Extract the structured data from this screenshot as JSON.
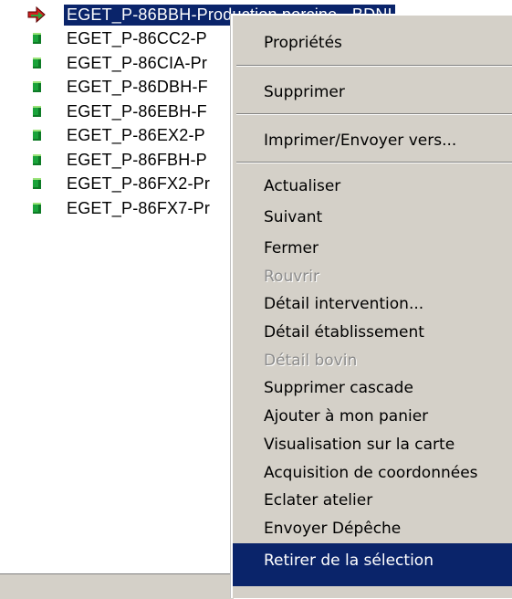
{
  "tree": {
    "items": [
      {
        "label": "EGET_P-86BBH-Production porcine - BDNI",
        "selected": true,
        "icon": "red-green-arrow-icon"
      },
      {
        "label": "EGET_P-86CC2-P",
        "selected": false,
        "icon": "green-square-icon"
      },
      {
        "label": "EGET_P-86CIA-Pr",
        "selected": false,
        "icon": "green-square-icon"
      },
      {
        "label": "EGET_P-86DBH-F",
        "selected": false,
        "icon": "green-square-icon"
      },
      {
        "label": "EGET_P-86EBH-F",
        "selected": false,
        "icon": "green-square-icon"
      },
      {
        "label": "EGET_P-86EX2-P",
        "selected": false,
        "icon": "green-square-icon"
      },
      {
        "label": "EGET_P-86FBH-P",
        "selected": false,
        "icon": "green-square-icon"
      },
      {
        "label": "EGET_P-86FX2-Pr",
        "selected": false,
        "icon": "green-square-icon"
      },
      {
        "label": "EGET_P-86FX7-Pr",
        "selected": false,
        "icon": "green-square-icon"
      }
    ]
  },
  "context_menu": {
    "items": [
      {
        "label": "Propriétés",
        "enabled": true
      },
      {
        "label": "Supprimer",
        "enabled": true
      },
      {
        "label": "Imprimer/Envoyer vers...",
        "enabled": true
      },
      {
        "label": "Actualiser",
        "enabled": true
      },
      {
        "label": "Suivant",
        "enabled": true
      },
      {
        "label": "Fermer",
        "enabled": true
      },
      {
        "label": "Rouvrir",
        "enabled": false
      },
      {
        "label": "Détail intervention...",
        "enabled": true
      },
      {
        "label": "Détail établissement",
        "enabled": true
      },
      {
        "label": "Détail bovin",
        "enabled": false
      },
      {
        "label": "Supprimer cascade",
        "enabled": true
      },
      {
        "label": "Ajouter à mon panier",
        "enabled": true
      },
      {
        "label": "Visualisation sur la carte",
        "enabled": true
      },
      {
        "label": "Acquisition de coordonnées",
        "enabled": true
      },
      {
        "label": "Eclater atelier",
        "enabled": true
      },
      {
        "label": "Envoyer Dépêche",
        "enabled": true
      },
      {
        "label": "Retirer de la sélection",
        "enabled": true,
        "highlighted": true
      }
    ]
  },
  "colors": {
    "selection": "#0a246a",
    "menu_bg": "#d4d0c8",
    "item_icon": "#1aa33a"
  }
}
